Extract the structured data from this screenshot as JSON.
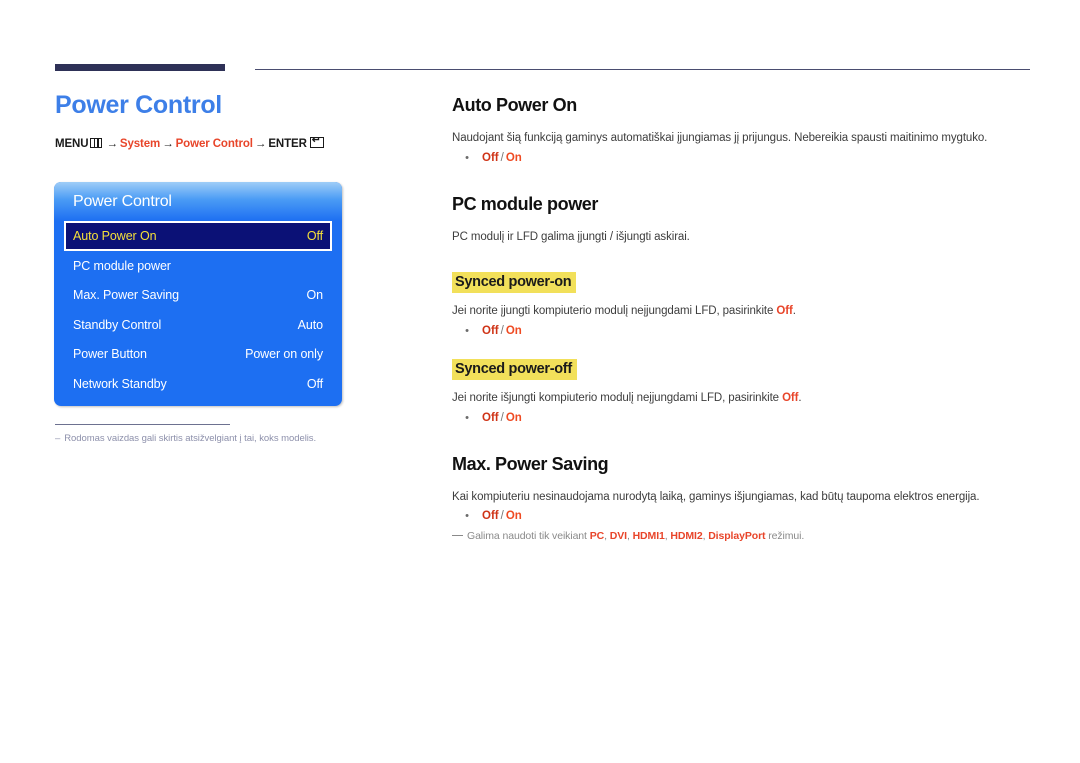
{
  "page": {
    "title": "Power Control",
    "breadcrumb": {
      "menu_label": "MENU",
      "menu_icon": "menu-grid-icon",
      "arrow": "→",
      "step1": "System",
      "step2": "Power Control",
      "enter_label": "ENTER",
      "enter_icon": "enter-key-icon"
    },
    "footnote": {
      "dash": "–",
      "text": "Rodomas vaizdas gali skirtis atsižvelgiant į tai, koks modelis."
    }
  },
  "osd": {
    "header": "Power Control",
    "rows": [
      {
        "label": "Auto Power On",
        "value": "Off",
        "selected": true
      },
      {
        "label": "PC module power",
        "value": "",
        "selected": false
      },
      {
        "label": "Max. Power Saving",
        "value": "On",
        "selected": false
      },
      {
        "label": "Standby Control",
        "value": "Auto",
        "selected": false
      },
      {
        "label": "Power Button",
        "value": "Power on only",
        "selected": false
      },
      {
        "label": "Network Standby",
        "value": "Off",
        "selected": false
      }
    ]
  },
  "sections": {
    "auto_power_on": {
      "heading": "Auto Power On",
      "body": "Naudojant šią funkciją gaminys automatiškai įjungiamas jį prijungus. Nebereikia spausti maitinimo mygtuko.",
      "bullet": {
        "dot": "•",
        "off": "Off",
        "sep": "/",
        "on": "On"
      }
    },
    "pc_module_power": {
      "heading": "PC module power",
      "body": "PC modulį ir LFD galima įjungti / išjungti askirai.",
      "synced_power_on": {
        "heading": "Synced power-on",
        "body_pre": "Jei norite įjungti kompiuterio modulį neįjungdami LFD, pasirinkite ",
        "body_em": "Off",
        "body_post": ".",
        "bullet": {
          "dot": "•",
          "off": "Off",
          "sep": "/",
          "on": "On"
        }
      },
      "synced_power_off": {
        "heading": "Synced power-off",
        "body_pre": "Jei norite išjungti kompiuterio modulį neįjungdami LFD, pasirinkite ",
        "body_em": "Off",
        "body_post": ".",
        "bullet": {
          "dot": "•",
          "off": "Off",
          "sep": "/",
          "on": "On"
        }
      }
    },
    "max_power_saving": {
      "heading": "Max. Power Saving",
      "body": "Kai kompiuteriu nesinaudojama nurodytą laiką, gaminys išjungiamas, kad būtų taupoma elektros energija.",
      "bullet": {
        "dot": "•",
        "off": "Off",
        "sep": "/",
        "on": "On"
      },
      "note": {
        "pre": "Galima naudoti tik veikiant ",
        "mode1": "PC",
        "mode2": "DVI",
        "mode3": "HDMI1",
        "mode4": "HDMI2",
        "mode5": "DisplayPort",
        "post": " režimui."
      }
    }
  },
  "colors": {
    "title_blue": "#3d7fe8",
    "accent_red": "#e8452a",
    "highlight_yellow": "#f2e05a",
    "osd_blue": "#1d6ff2",
    "osd_selected_navy": "#0b1176",
    "osd_selected_text": "#f5e03a",
    "rule_navy": "#2e3157"
  }
}
